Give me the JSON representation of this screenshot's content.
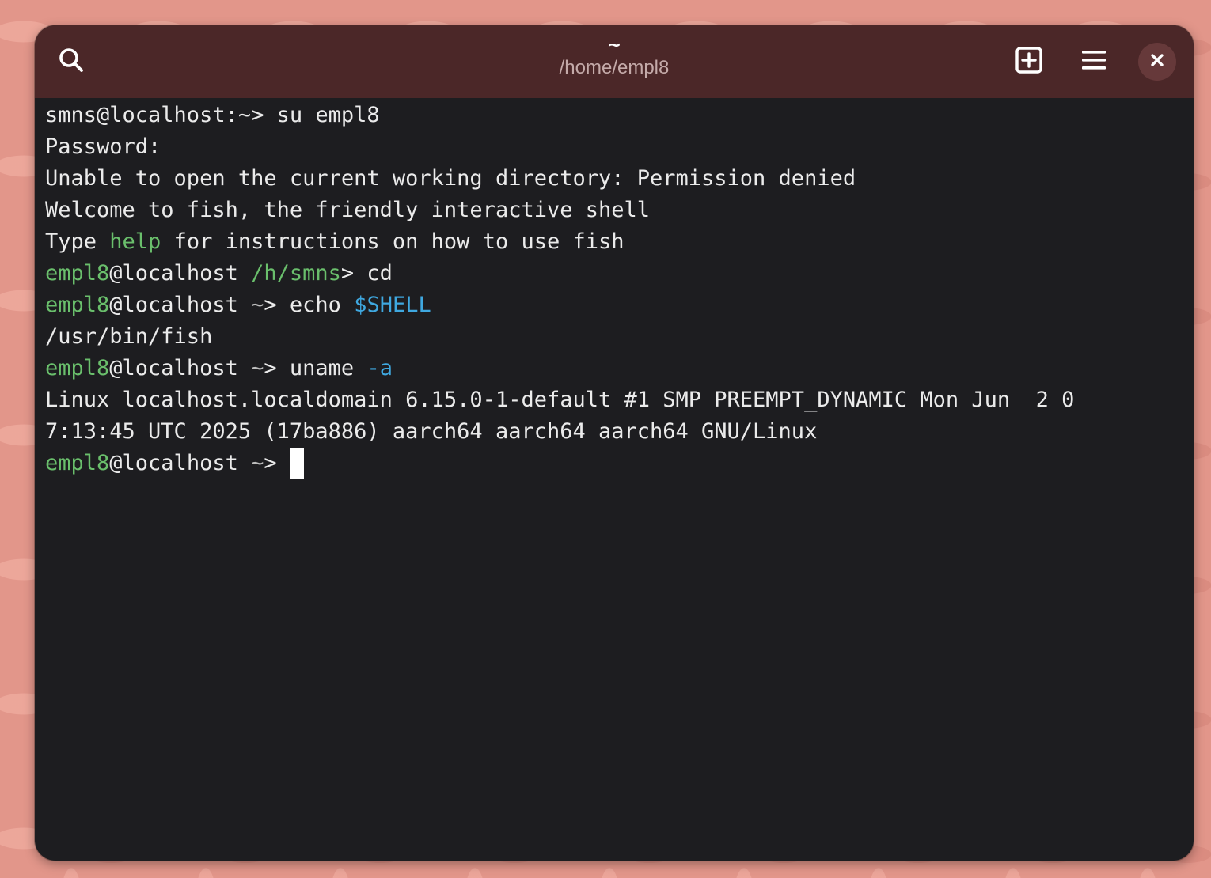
{
  "window": {
    "title": "~",
    "subtitle": "/home/empl8"
  },
  "icons": {
    "search": "search-icon",
    "new_tab": "new-tab-icon",
    "menu": "hamburger-menu-icon",
    "close": "close-icon"
  },
  "colors": {
    "headerbar": "#4b2728",
    "terminal_bg": "#1d1d20",
    "prompt_user": "#6abf6c",
    "variable": "#3fa8e0",
    "foreground": "#ebebeb"
  },
  "terminal": {
    "line1": {
      "prompt": "smns@localhost:~>",
      "command": " su empl8"
    },
    "line2": {
      "text": "Password:"
    },
    "line3": {
      "text": "Unable to open the current working directory: Permission denied"
    },
    "line4": {
      "text": "Welcome to fish, the friendly interactive shell"
    },
    "line5": {
      "pre": "Type ",
      "help": "help",
      "post": " for instructions on how to use fish"
    },
    "line6": {
      "user": "empl8",
      "host": "@localhost",
      "cwd": "/h/smns",
      "arrow": ">",
      "command": " cd"
    },
    "line7": {
      "user": "empl8",
      "host": "@localhost",
      "cwd": "~",
      "arrow": ">",
      "command": " echo ",
      "var": "$SHELL"
    },
    "line8": {
      "text": "/usr/bin/fish"
    },
    "line9": {
      "user": "empl8",
      "host": "@localhost",
      "cwd": "~",
      "arrow": ">",
      "command": " uname ",
      "flag": "-a"
    },
    "line10": {
      "text": "Linux localhost.localdomain 6.15.0-1-default #1 SMP PREEMPT_DYNAMIC Mon Jun  2 0"
    },
    "line11": {
      "text": "7:13:45 UTC 2025 (17ba886) aarch64 aarch64 aarch64 GNU/Linux"
    },
    "line12": {
      "user": "empl8",
      "host": "@localhost",
      "cwd": "~",
      "arrow": ">",
      "space": " "
    }
  }
}
